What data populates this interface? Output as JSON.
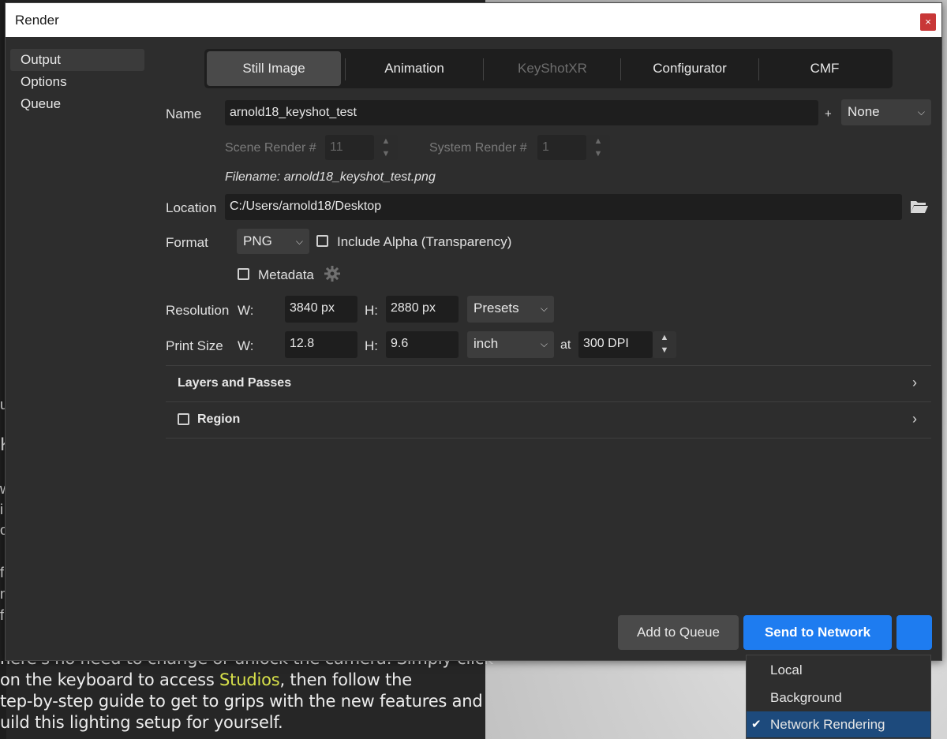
{
  "background": {
    "lines": [
      {
        "prefix": "",
        "text": "here's no need to change or unlock the camera. Simply click",
        "highlight": "",
        "suffix": ""
      },
      {
        "prefix": " on the keyboard to access ",
        "text": "",
        "highlight": "Studios",
        "suffix": ", then follow the"
      },
      {
        "prefix": "tep-by-step guide to get to grips with the new features and",
        "text": "",
        "highlight": "",
        "suffix": ""
      },
      {
        "prefix": "uild this lighting setup for yourself.",
        "text": "",
        "highlight": "",
        "suffix": ""
      }
    ],
    "edge_chars": [
      "u",
      "K",
      "w",
      "i",
      "o",
      "f",
      "n",
      "f"
    ]
  },
  "dialog": {
    "title": "Render",
    "close_label": "×",
    "nav": [
      "Output",
      "Options",
      "Queue"
    ],
    "active_nav": "Output",
    "tabs": [
      {
        "label": "Still Image",
        "state": "active"
      },
      {
        "label": "Animation",
        "state": "normal"
      },
      {
        "label": "KeyShotXR",
        "state": "disabled"
      },
      {
        "label": "Configurator",
        "state": "normal"
      },
      {
        "label": "CMF",
        "state": "normal"
      }
    ],
    "name": {
      "label": "Name",
      "value": "arnold18_keyshot_test",
      "plus": "+",
      "suffix_select": "None"
    },
    "scene_render": {
      "label": "Scene Render #",
      "value": "11"
    },
    "system_render": {
      "label": "System Render #",
      "value": "1"
    },
    "filename": "Filename: arnold18_keyshot_test.png",
    "location": {
      "label": "Location",
      "value": "C:/Users/arnold18/Desktop"
    },
    "format": {
      "label": "Format",
      "value": "PNG",
      "alpha_label": "Include Alpha (Transparency)",
      "metadata_label": "Metadata"
    },
    "resolution": {
      "label": "Resolution",
      "w_label": "W:",
      "w": "3840 px",
      "h_label": "H:",
      "h": "2880 px",
      "presets": "Presets"
    },
    "print_size": {
      "label": "Print Size",
      "w_label": "W:",
      "w": "12.8",
      "h_label": "H:",
      "h": "9.6",
      "unit": "inch",
      "at_label": "at",
      "dpi": "300 DPI"
    },
    "sections": [
      "Layers and Passes",
      "Region"
    ],
    "buttons": {
      "add_queue": "Add to Queue",
      "send_network": "Send to Network"
    },
    "menu": {
      "items": [
        "Local",
        "Background",
        "Network Rendering"
      ],
      "selected": "Network Rendering",
      "check": "✔"
    }
  },
  "colors": {
    "accent": "#1e7cf0",
    "menu_selected": "#1d4a7c",
    "close": "#c83737"
  }
}
